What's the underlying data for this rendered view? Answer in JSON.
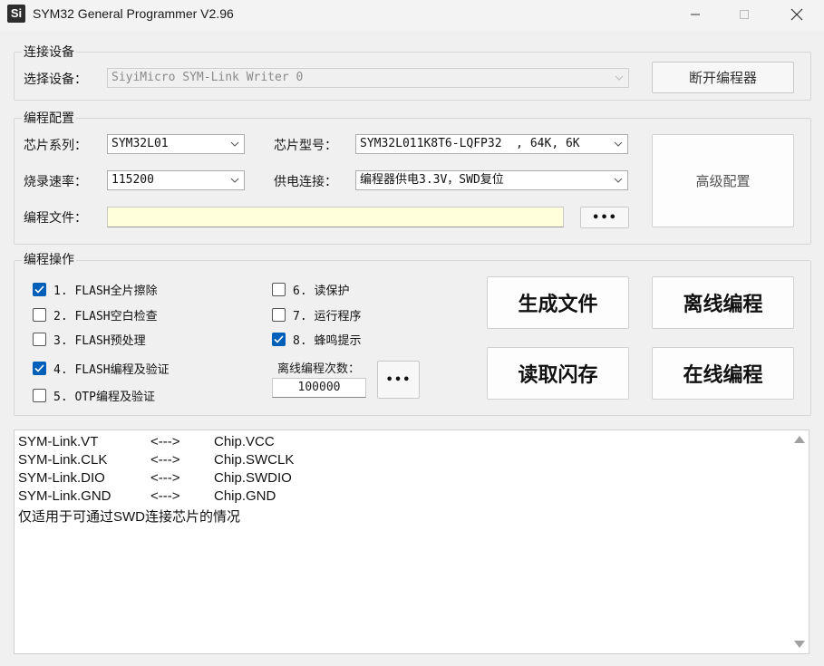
{
  "window": {
    "icon_text": "Si",
    "title": "SYM32 General Programmer V2.96"
  },
  "connect": {
    "group_label": "连接设备",
    "device_label": "选择设备：",
    "device_value": "SiyiMicro SYM-Link Writer 0",
    "disconnect_button": "断开编程器"
  },
  "config": {
    "group_label": "编程配置",
    "chip_series_label": "芯片系列：",
    "chip_series_value": "SYM32L01",
    "chip_model_label": "芯片型号：",
    "chip_model_value": "SYM32L011K8T6-LQFP32  , 64K, 6K",
    "speed_label": "烧录速率：",
    "speed_value": "115200",
    "power_label": "供电连接：",
    "power_value": "编程器供电3.3V，SWD复位",
    "file_label": "编程文件：",
    "file_value": "",
    "browse_button": "•••",
    "advanced_button": "高级配置"
  },
  "ops": {
    "group_label": "编程操作",
    "checks": [
      {
        "label": "1. FLASH全片擦除",
        "checked": true
      },
      {
        "label": "2. FLASH空白检查",
        "checked": false
      },
      {
        "label": "3. FLASH预处理",
        "checked": false
      },
      {
        "label": "4. FLASH编程及验证",
        "checked": true
      },
      {
        "label": "5. OTP编程及验证",
        "checked": false
      },
      {
        "label": "6. 读保护",
        "checked": false
      },
      {
        "label": "7. 运行程序",
        "checked": false
      },
      {
        "label": "8. 蜂鸣提示",
        "checked": true
      }
    ],
    "offline_count_label": "离线编程次数：",
    "offline_count_value": "100000",
    "count_more_button": "•••",
    "generate_button": "生成文件",
    "offline_button": "离线编程",
    "read_button": "读取闪存",
    "online_button": "在线编程"
  },
  "log": {
    "lines": [
      {
        "left": "SYM-Link.VT",
        "arrow": "<--->",
        "right": "Chip.VCC"
      },
      {
        "left": "SYM-Link.CLK",
        "arrow": "<--->",
        "right": "Chip.SWCLK"
      },
      {
        "left": "SYM-Link.DIO",
        "arrow": "<--->",
        "right": "Chip.SWDIO"
      },
      {
        "left": "SYM-Link.GND",
        "arrow": "<--->",
        "right": "Chip.GND"
      }
    ],
    "note": "仅适用于可通过SWD连接芯片的情况"
  }
}
